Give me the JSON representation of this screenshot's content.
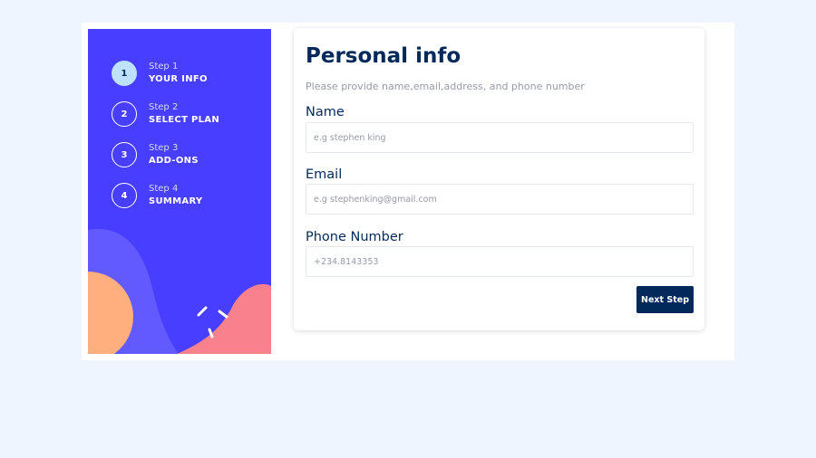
{
  "sidebar": {
    "steps": [
      {
        "number": "1",
        "label": "Step 1",
        "title": "YOUR INFO"
      },
      {
        "number": "2",
        "label": "Step 2",
        "title": "SELECT PLAN"
      },
      {
        "number": "3",
        "label": "Step 3",
        "title": "ADD-ONS"
      },
      {
        "number": "4",
        "label": "Step 4",
        "title": "SUMMARY"
      }
    ],
    "active_step": 1
  },
  "form": {
    "title": "Personal info",
    "subtitle": "Please provide name,email,address, and phone number",
    "fields": [
      {
        "label": "Name",
        "placeholder": "e.g stephen king"
      },
      {
        "label": "Email",
        "placeholder": "e.g stephenking@gmail.com"
      },
      {
        "label": "Phone Number",
        "placeholder": "+234.8143353"
      }
    ],
    "next_label": "Next Step"
  },
  "colors": {
    "page_background": "#eff5ff",
    "sidebar_background": "#483eff",
    "active_step": "#bee2fd",
    "primary_text": "#02295a",
    "secondary_text": "#9699ab"
  }
}
